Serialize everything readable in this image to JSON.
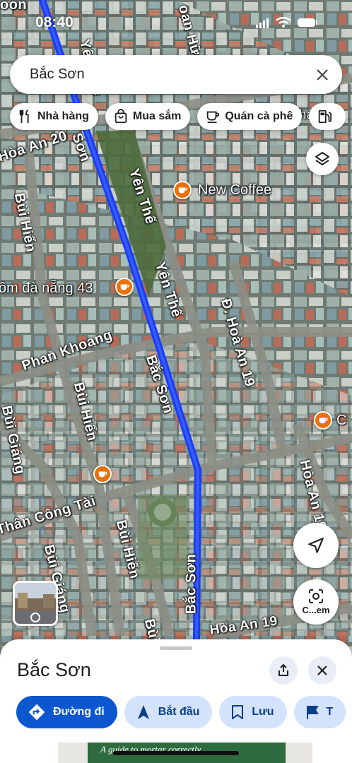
{
  "status_bar": {
    "time": "08:40"
  },
  "search": {
    "query": "Bắc Sơn"
  },
  "chips": [
    {
      "label": "Nhà hàng",
      "icon": "fork-knife-icon"
    },
    {
      "label": "Mua sắm",
      "icon": "shopping-bag-icon"
    },
    {
      "label": "Quán cà phê",
      "icon": "coffee-cup-icon"
    },
    {
      "label": "",
      "icon": "gas-station-icon"
    }
  ],
  "map": {
    "road_labels": [
      {
        "text": "Yên Thế",
        "id": "yen-the-top"
      },
      {
        "text": "Sơn",
        "id": "bac-son-top"
      },
      {
        "text": "Hòa An 20",
        "id": "hoa-an-20"
      },
      {
        "text": "Bùi Hiển",
        "id": "bui-hien-1"
      },
      {
        "text": "Yên Thế",
        "id": "yen-the-mid"
      },
      {
        "text": "Yên Thế",
        "id": "yen-the-low"
      },
      {
        "text": "Đ. Hoà An 19",
        "id": "hoa-an-19-a"
      },
      {
        "text": "Phan Khoang",
        "id": "phan-khoang"
      },
      {
        "text": "Bắc Sơn",
        "id": "bac-son-mid"
      },
      {
        "text": "Bùi Hiển",
        "id": "bui-hien-2"
      },
      {
        "text": "Bùi Giáng",
        "id": "bui-giang-1"
      },
      {
        "text": "Hòa An 19",
        "id": "hoa-an-19-b"
      },
      {
        "text": "Thân Công Tài",
        "id": "than-cong-tai"
      },
      {
        "text": "Bùi Giáng",
        "id": "bui-giang-2"
      },
      {
        "text": "Bùi Hiển",
        "id": "bui-hien-3"
      },
      {
        "text": "Bắc Sơn",
        "id": "bac-son-low"
      },
      {
        "text": "Bùi",
        "id": "bui-low"
      },
      {
        "text": "Hòa An 19",
        "id": "hoa-an-19-c"
      },
      {
        "text": "oan Hữu",
        "id": "doan-huu"
      },
      {
        "text": "oon",
        "id": "corner-oon"
      },
      {
        "text": "Huệ Thành L",
        "id": "hue-thanh"
      }
    ],
    "pois": [
      {
        "name": "New Coffee",
        "id": "new-coffee"
      },
      {
        "name": "ôm đà nẵng 43",
        "id": "om-da-nang"
      },
      {
        "name": "C",
        "id": "poi-c"
      },
      {
        "name": "",
        "id": "poi-cafe"
      }
    ]
  },
  "camera_button": {
    "label": "C...em"
  },
  "place": {
    "title": "Bắc Sơn",
    "actions": [
      {
        "label": "Đường đi",
        "icon": "directions-icon",
        "style": "primary"
      },
      {
        "label": "Bắt đầu",
        "icon": "navigation-arrow-icon",
        "style": "secondary"
      },
      {
        "label": "Lưu",
        "icon": "bookmark-icon",
        "style": "secondary"
      },
      {
        "label": "T",
        "icon": "flag-icon",
        "style": "secondary"
      }
    ],
    "preview_text": "A guide to mortar correctly"
  },
  "colors": {
    "route": "#1a3cff",
    "primary": "#0b57d0",
    "secondary_chip": "#d3e3fd",
    "poi": "#e8710a"
  }
}
